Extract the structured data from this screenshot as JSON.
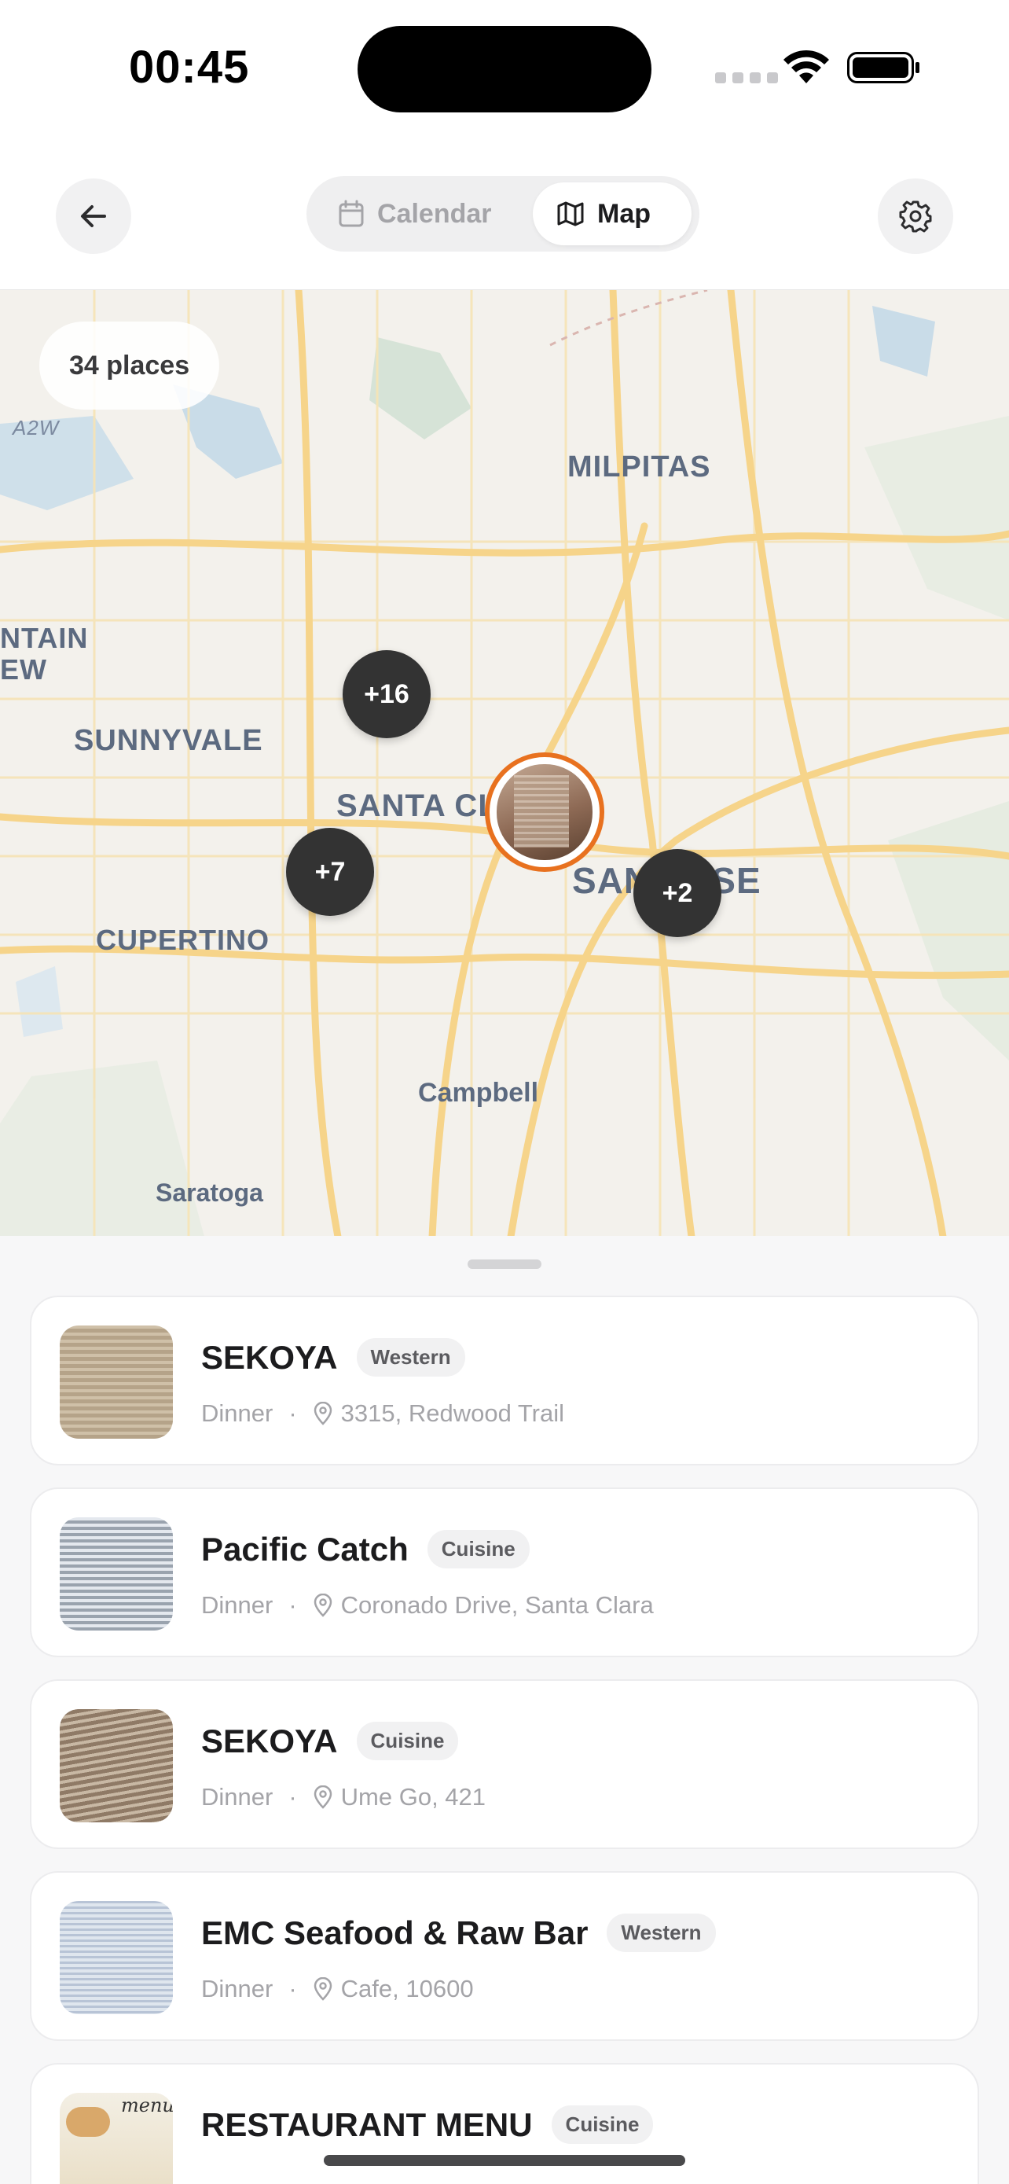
{
  "status_bar": {
    "time": "00:45"
  },
  "header": {
    "tabs": [
      {
        "label": "Calendar",
        "icon": "calendar-icon",
        "selected": false
      },
      {
        "label": "Map",
        "icon": "map-icon",
        "selected": true
      }
    ]
  },
  "map": {
    "places_count_label": "34 places",
    "city_labels": [
      "MILPITAS",
      "NTAIN",
      "EW",
      "SUNNYVALE",
      "SANTA CL",
      "SAN JOSE",
      "CUPERTINO",
      "Campbell",
      "Saratoga"
    ],
    "road_label": "A2W",
    "clusters": [
      "+16",
      "+7",
      "+2"
    ]
  },
  "places": [
    {
      "name": "SEKOYA",
      "tag": "Western",
      "meal": "Dinner",
      "address": "3315, Redwood Trail"
    },
    {
      "name": "Pacific Catch",
      "tag": "Cuisine",
      "meal": "Dinner",
      "address": "Coronado Drive, Santa Clara"
    },
    {
      "name": "SEKOYA",
      "tag": "Cuisine",
      "meal": "Dinner",
      "address": "Ume Go, 421"
    },
    {
      "name": "EMC Seafood & Raw Bar",
      "tag": "Western",
      "meal": "Dinner",
      "address": "Cafe, 10600"
    },
    {
      "name": "RESTAURANT MENU",
      "tag": "Cuisine",
      "thumb_text": "menu"
    }
  ],
  "colors": {
    "accent_marker": "#e8711f",
    "cluster": "#333333",
    "map_road": "#f6d48a"
  }
}
